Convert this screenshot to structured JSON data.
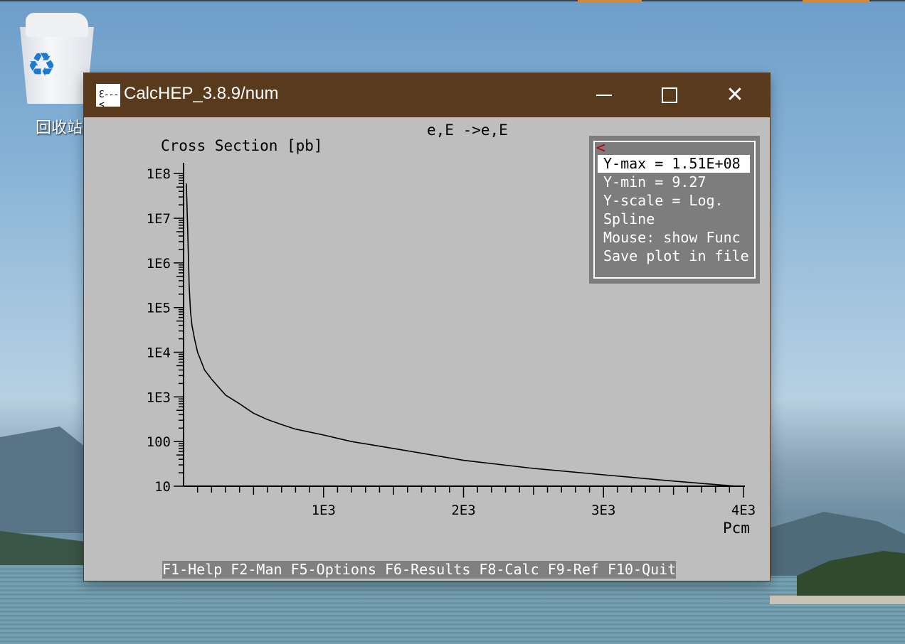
{
  "desktop": {
    "recycle_bin_label": "回收站"
  },
  "window": {
    "title": "CalcHEP_3.8.9/num",
    "controls": {
      "minimize": "minimize",
      "maximize": "maximize",
      "close": "close"
    }
  },
  "plot": {
    "process": "e,E ->e,E",
    "y_label": "Cross Section [pb]",
    "x_label": "Pcm"
  },
  "menu": {
    "back_symbol": "<",
    "items": [
      {
        "label": "Y-max = 1.51E+08",
        "selected": true
      },
      {
        "label": "Y-min = 9.27",
        "selected": false
      },
      {
        "label": "Y-scale = Log.",
        "selected": false
      },
      {
        "label": "Spline",
        "selected": false
      },
      {
        "label": "Mouse: show Func",
        "selected": false
      },
      {
        "label": "Save plot in file",
        "selected": false
      }
    ]
  },
  "function_keys": [
    {
      "label": "F1-Help"
    },
    {
      "label": "F2-Man"
    },
    {
      "label": "F5-Options"
    },
    {
      "label": "F6-Results"
    },
    {
      "label": "F8-Calc"
    },
    {
      "label": "F9-Ref"
    },
    {
      "label": "F10-Quit"
    }
  ],
  "chart_data": {
    "type": "line",
    "title": "e,E ->e,E",
    "xlabel": "Pcm",
    "ylabel": "Cross Section [pb]",
    "y_scale": "log",
    "xlim": [
      0,
      4000
    ],
    "ylim": [
      10,
      151000000
    ],
    "x_ticks": [
      1000,
      2000,
      3000,
      4000
    ],
    "x_tick_labels": [
      "1E3",
      "2E3",
      "3E3",
      "4E3"
    ],
    "y_ticks": [
      10,
      100,
      1000,
      10000,
      100000,
      1000000,
      10000000,
      100000000
    ],
    "y_tick_labels": [
      "10",
      "100",
      "1E3",
      "1E4",
      "1E5",
      "1E6",
      "1E7",
      "1E8"
    ],
    "grid": false,
    "series": [
      {
        "x": [
          20,
          30,
          40,
          50,
          60,
          80,
          100,
          150,
          200,
          300,
          400,
          500,
          600,
          700,
          800,
          1000,
          1200,
          1500,
          2000,
          2500,
          3000,
          3500,
          3950
        ],
        "y": [
          60000000,
          5000000,
          300000,
          80000,
          40000,
          19000,
          10000,
          4000,
          2500,
          1100,
          700,
          430,
          310,
          240,
          190,
          140,
          100,
          70,
          38,
          25,
          18,
          13,
          10
        ]
      }
    ]
  }
}
